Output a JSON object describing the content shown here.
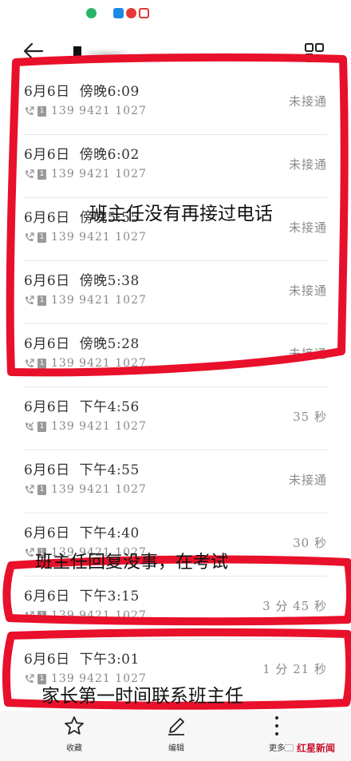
{
  "calls": [
    {
      "date": "6月6日",
      "time": "傍晚6:09",
      "number": "139 9421 1027",
      "status": "未接通",
      "direction": "out"
    },
    {
      "date": "6月6日",
      "time": "傍晚6:02",
      "number": "139 9421 1027",
      "status": "未接通",
      "direction": "out"
    },
    {
      "date": "6月6日",
      "time": "傍晚5:55",
      "number": "139 9421 1027",
      "status": "未接通",
      "direction": "out"
    },
    {
      "date": "6月6日",
      "time": "傍晚5:38",
      "number": "139 9421 1027",
      "status": "未接通",
      "direction": "out"
    },
    {
      "date": "6月6日",
      "time": "傍晚5:28",
      "number": "139 9421 1027",
      "status": "未接通",
      "direction": "out"
    },
    {
      "date": "6月6日",
      "time": "下午4:56",
      "number": "139 9421 1027",
      "status": "35 秒",
      "direction": "in"
    },
    {
      "date": "6月6日",
      "time": "下午4:55",
      "number": "139 9421 1027",
      "status": "未接通",
      "direction": "out"
    },
    {
      "date": "6月6日",
      "time": "下午4:40",
      "number": "139 9421 1027",
      "status": "30 秒",
      "direction": "out"
    },
    {
      "date": "6月6日",
      "time": "下午3:15",
      "number": "139 9421 1027",
      "status": "3 分 45 秒",
      "direction": "out"
    },
    {
      "date": "6月6日",
      "time": "下午3:01",
      "number": "139 9421 1027",
      "status": "1 分 21 秒",
      "direction": "out"
    }
  ],
  "sim_label": "1",
  "annotations": {
    "top": "班主任没有再接过电话",
    "middle": "班主任回复没事，在考试",
    "bottom": "家长第一时间联系班主任"
  },
  "toolbar": {
    "favorite_label": "收藏",
    "edit_label": "编辑",
    "more_label": "更多"
  },
  "watermark": {
    "brand": "红星新闻"
  },
  "colors": {
    "annotation_red": "#e8102a",
    "brand_red": "#c8102e",
    "status_gray": "#8a8a8a"
  }
}
